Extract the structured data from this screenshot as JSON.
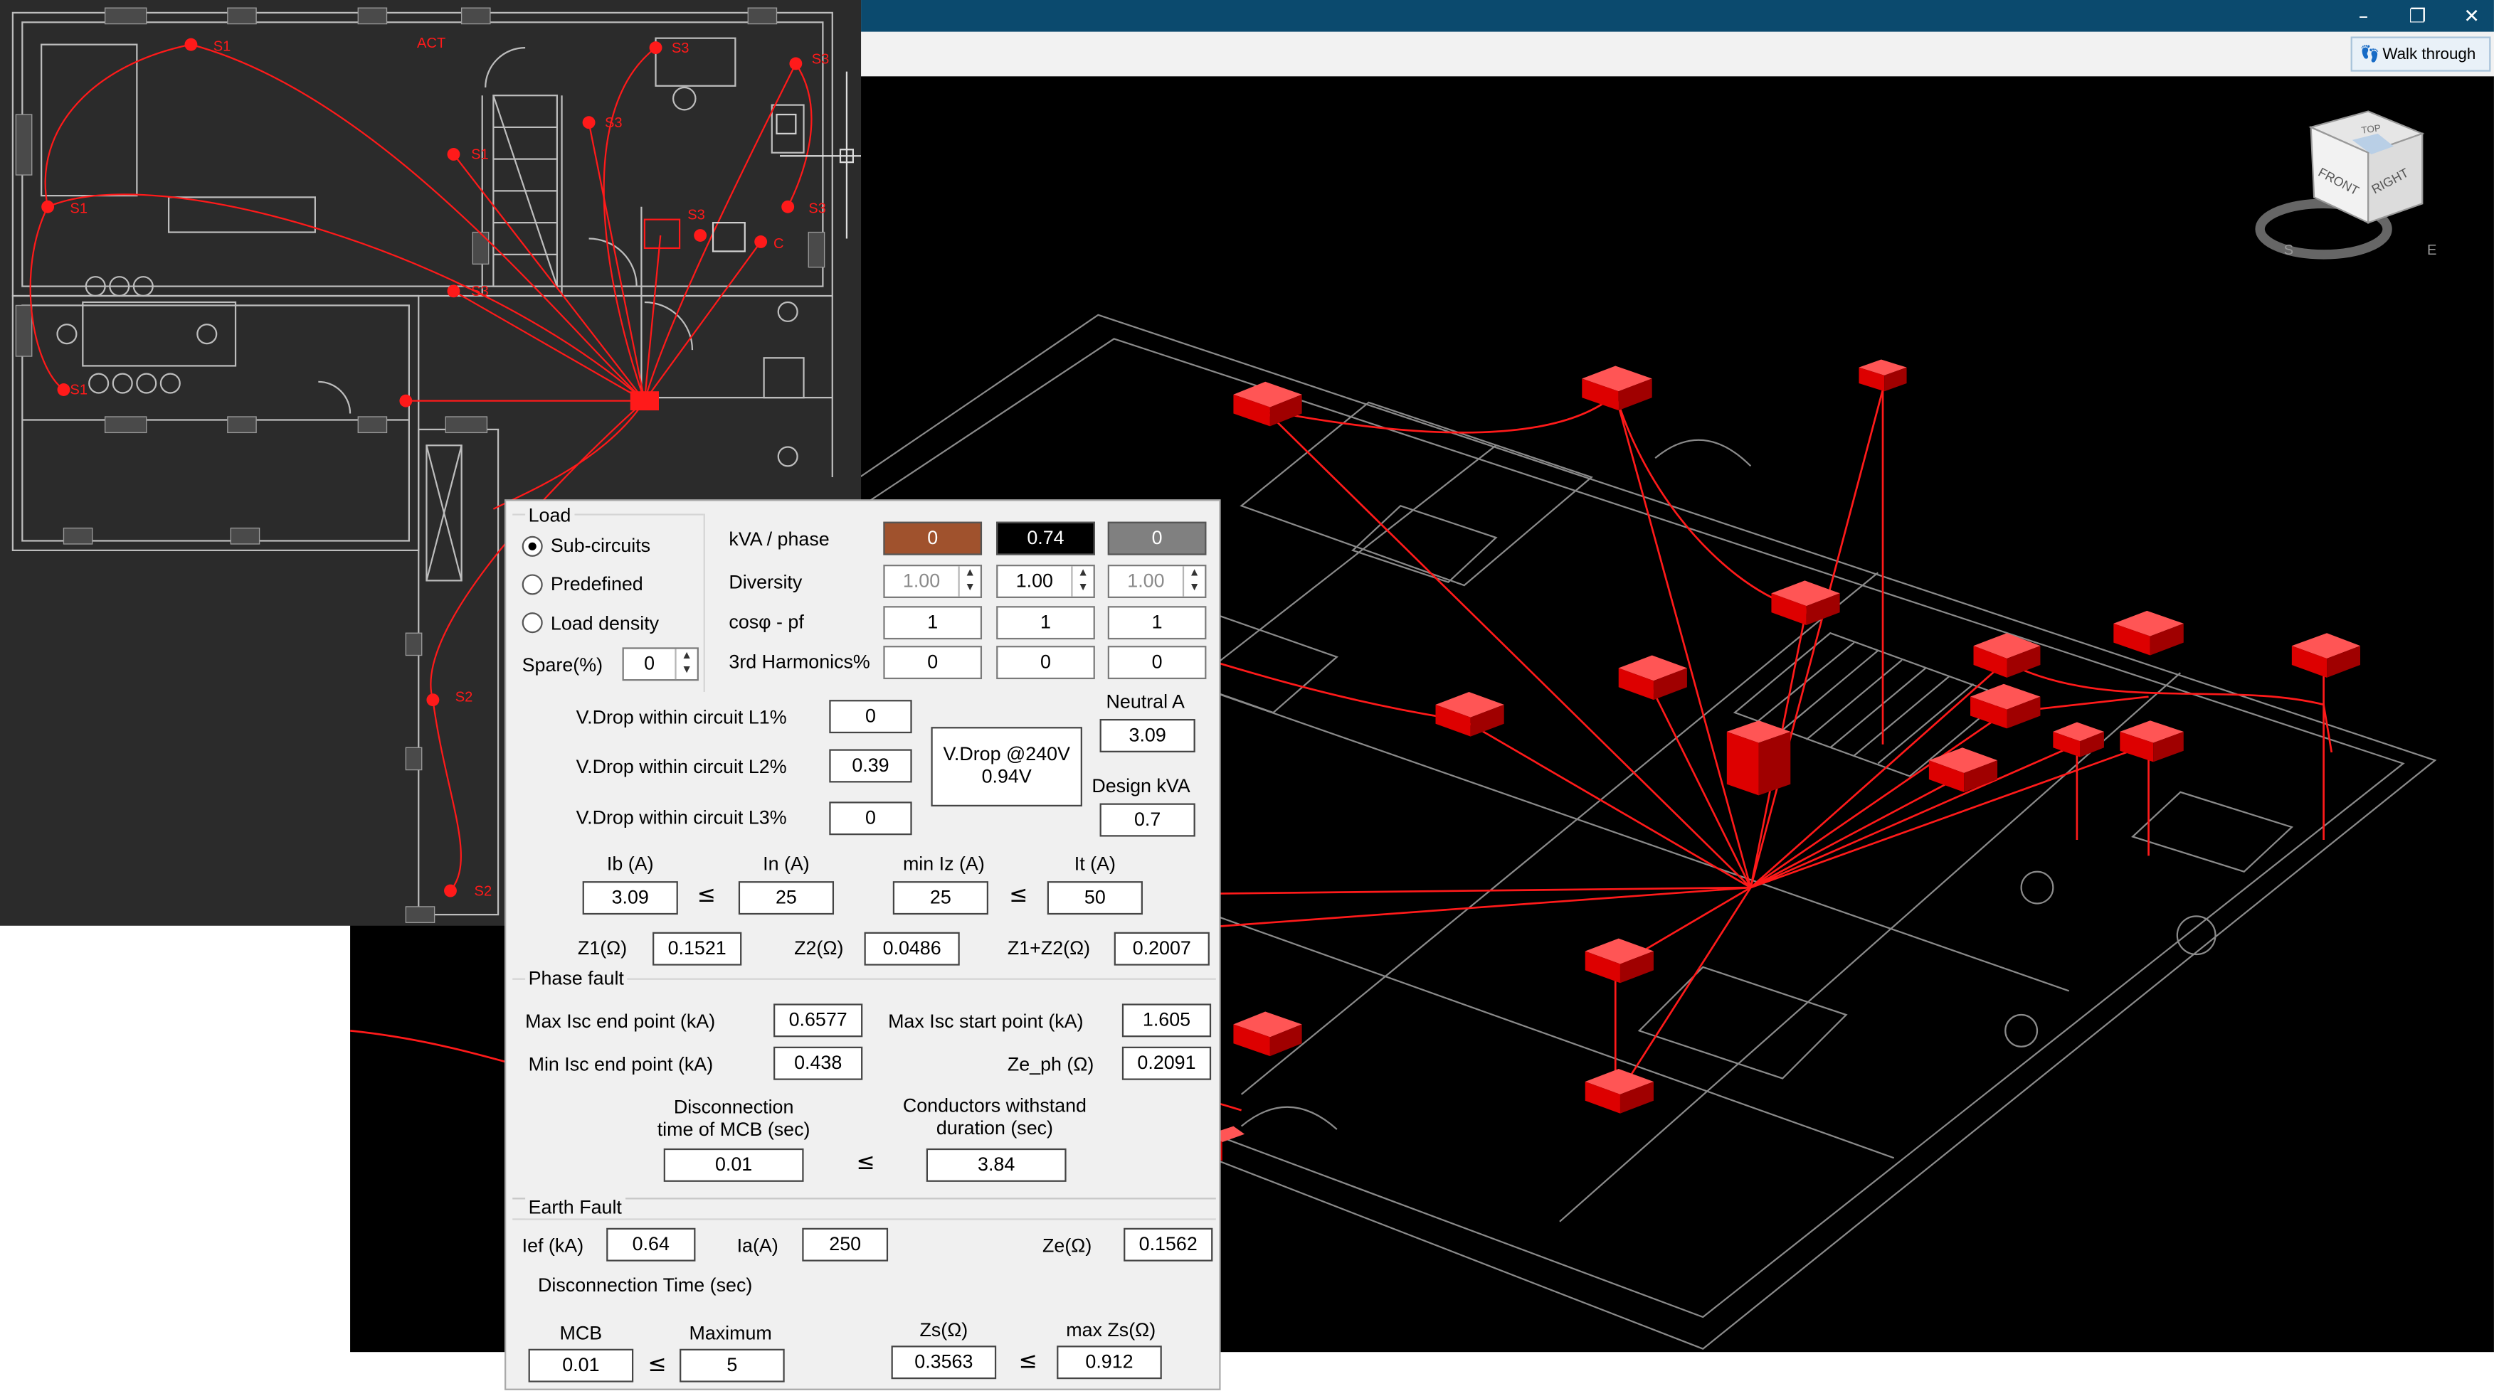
{
  "window": {
    "controls": {
      "minimize": "–",
      "restore": "❐",
      "close": "✕"
    },
    "walk_through_label": "Walk through"
  },
  "viewcube": {
    "top": "TOP",
    "front": "FRONT",
    "right": "RIGHT",
    "south": "S",
    "east": "E"
  },
  "plan": {
    "labels": [
      "S1",
      "ACT",
      "S3",
      "S3",
      "S1",
      "S3",
      "S1",
      "S3",
      "S3",
      "C",
      "S3",
      "S1",
      "S2",
      "S2"
    ]
  },
  "dialog": {
    "load_group": "Load",
    "load_options": [
      {
        "label": "Sub-circuits",
        "selected": true
      },
      {
        "label": "Predefined",
        "selected": false
      },
      {
        "label": "Load density",
        "selected": false
      }
    ],
    "spare_label": "Spare(%)",
    "spare_value": "0",
    "rows": {
      "kva_label": "kVA / phase",
      "kva_values": [
        "0",
        "0.74",
        "0"
      ],
      "diversity_label": "Diversity",
      "diversity_values": [
        "1.00",
        "1.00",
        "1.00"
      ],
      "cos_label": "cosφ - pf",
      "cos_values": [
        "1",
        "1",
        "1"
      ],
      "harm_label": "3rd Harmonics%",
      "harm_values": [
        "0",
        "0",
        "0"
      ]
    },
    "phase_colors": {
      "l1": "#a0522d",
      "l2": "#000000",
      "l3": "#808080"
    },
    "vdrop": {
      "l1_label": "V.Drop within circuit L1%",
      "l1_value": "0",
      "l2_label": "V.Drop within circuit L2%",
      "l2_value": "0.39",
      "l3_label": "V.Drop within circuit L3%",
      "l3_value": "0",
      "summary_line1": "V.Drop @240V",
      "summary_line2": "0.94V"
    },
    "neutral_label": "Neutral A",
    "neutral_value": "3.09",
    "design_kva_label": "Design kVA",
    "design_kva_value": "0.7",
    "currents": {
      "ib_label": "Ib (A)",
      "ib_value": "3.09",
      "in_label": "In (A)",
      "in_value": "25",
      "miniz_label": "min Iz (A)",
      "miniz_value": "25",
      "it_label": "It (A)",
      "it_value": "50",
      "le": "≤"
    },
    "impedance": {
      "z1_label": "Z1(Ω)",
      "z1_value": "0.1521",
      "z2_label": "Z2(Ω)",
      "z2_value": "0.0486",
      "z12_label": "Z1+Z2(Ω)",
      "z12_value": "0.2007"
    },
    "phase_fault": {
      "title": "Phase fault",
      "max_isc_end_label": "Max Isc end point (kA)",
      "max_isc_end_value": "0.6577",
      "max_isc_start_label": "Max Isc start point (kA)",
      "max_isc_start_value": "1.605",
      "min_isc_end_label": "Min Isc end point (kA)",
      "min_isc_end_value": "0.438",
      "ze_ph_label": "Ze_ph (Ω)",
      "ze_ph_value": "0.2091",
      "disc_line1": "Disconnection",
      "disc_line2": "time of MCB (sec)",
      "disc_value": "0.01",
      "withstand_line1": "Conductors withstand",
      "withstand_line2": "duration (sec)",
      "withstand_value": "3.84"
    },
    "earth_fault": {
      "title": "Earth Fault",
      "ief_label": "Ief (kA)",
      "ief_value": "0.64",
      "ia_label": "Ia(A)",
      "ia_value": "250",
      "ze_label": "Ze(Ω)",
      "ze_value": "0.1562",
      "disc_time_label": "Disconnection Time (sec)",
      "mcb_label": "MCB",
      "mcb_value": "0.01",
      "maximum_label": "Maximum",
      "maximum_value": "5",
      "zs_label": "Zs(Ω)",
      "zs_value": "0.3563",
      "maxzs_label": "max Zs(Ω)",
      "maxzs_value": "0.912"
    }
  }
}
